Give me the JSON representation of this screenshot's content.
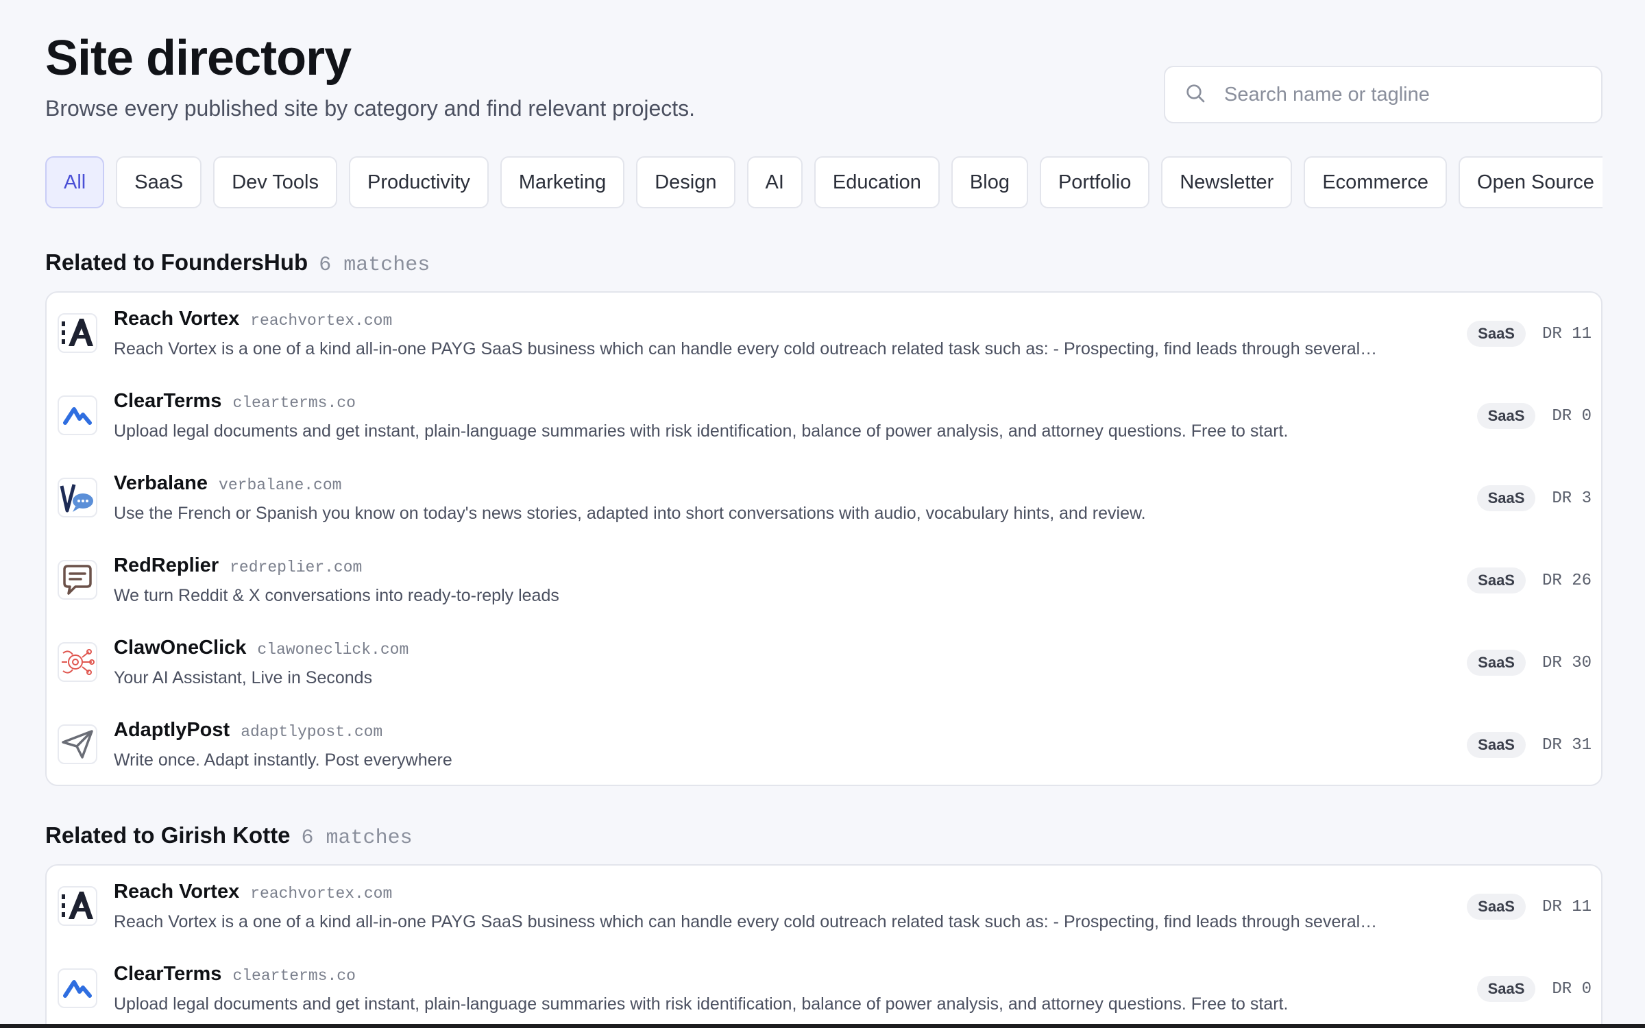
{
  "header": {
    "title": "Site directory",
    "subtitle": "Browse every published site by category and find relevant projects."
  },
  "search": {
    "placeholder": "Search name or tagline",
    "value": "",
    "icon": "search-icon"
  },
  "filters": [
    {
      "label": "All",
      "active": true
    },
    {
      "label": "SaaS",
      "active": false
    },
    {
      "label": "Dev Tools",
      "active": false
    },
    {
      "label": "Productivity",
      "active": false
    },
    {
      "label": "Marketing",
      "active": false
    },
    {
      "label": "Design",
      "active": false
    },
    {
      "label": "AI",
      "active": false
    },
    {
      "label": "Education",
      "active": false
    },
    {
      "label": "Blog",
      "active": false
    },
    {
      "label": "Portfolio",
      "active": false
    },
    {
      "label": "Newsletter",
      "active": false
    },
    {
      "label": "Ecommerce",
      "active": false
    },
    {
      "label": "Open Source",
      "active": false
    }
  ],
  "sections": [
    {
      "title": "Related to FoundersHub",
      "count": "6 matches",
      "rows": [
        {
          "name": "Reach Vortex",
          "domain": "reachvortex.com",
          "desc": "Reach Vortex is a one of a kind all-in-one PAYG SaaS business which can handle every cold outreach related task such as: - Prospecting, find leads through several…",
          "badge": "SaaS",
          "dr": "DR 11",
          "logo": "reachvortex-logo-icon"
        },
        {
          "name": "ClearTerms",
          "domain": "clearterms.co",
          "desc": "Upload legal documents and get instant, plain-language summaries with risk identification, balance of power analysis, and attorney questions. Free to start.",
          "badge": "SaaS",
          "dr": "DR 0",
          "logo": "clearterms-logo-icon"
        },
        {
          "name": "Verbalane",
          "domain": "verbalane.com",
          "desc": "Use the French or Spanish you know on today's news stories, adapted into short conversations with audio, vocabulary hints, and review.",
          "badge": "SaaS",
          "dr": "DR 3",
          "logo": "verbalane-logo-icon"
        },
        {
          "name": "RedReplier",
          "domain": "redreplier.com",
          "desc": "We turn Reddit & X conversations into ready-to-reply leads",
          "badge": "SaaS",
          "dr": "DR 26",
          "logo": "chat-bubble-icon"
        },
        {
          "name": "ClawOneClick",
          "domain": "clawoneclick.com",
          "desc": "Your AI Assistant, Live in Seconds",
          "badge": "SaaS",
          "dr": "DR 30",
          "logo": "claw-logo-icon"
        },
        {
          "name": "AdaptlyPost",
          "domain": "adaptlypost.com",
          "desc": "Write once. Adapt instantly. Post everywhere",
          "badge": "SaaS",
          "dr": "DR 31",
          "logo": "paper-plane-icon"
        }
      ]
    },
    {
      "title": "Related to Girish Kotte",
      "count": "6 matches",
      "rows": [
        {
          "name": "Reach Vortex",
          "domain": "reachvortex.com",
          "desc": "Reach Vortex is a one of a kind all-in-one PAYG SaaS business which can handle every cold outreach related task such as: - Prospecting, find leads through several…",
          "badge": "SaaS",
          "dr": "DR 11",
          "logo": "reachvortex-logo-icon"
        },
        {
          "name": "ClearTerms",
          "domain": "clearterms.co",
          "desc": "Upload legal documents and get instant, plain-language summaries with risk identification, balance of power analysis, and attorney questions. Free to start.",
          "badge": "SaaS",
          "dr": "DR 0",
          "logo": "clearterms-logo-icon"
        }
      ]
    }
  ],
  "colors": {
    "background": "#f6f7fb",
    "accent": "#4a4fd6",
    "accent_bg": "#eceefe",
    "border": "#e3e5ec"
  }
}
